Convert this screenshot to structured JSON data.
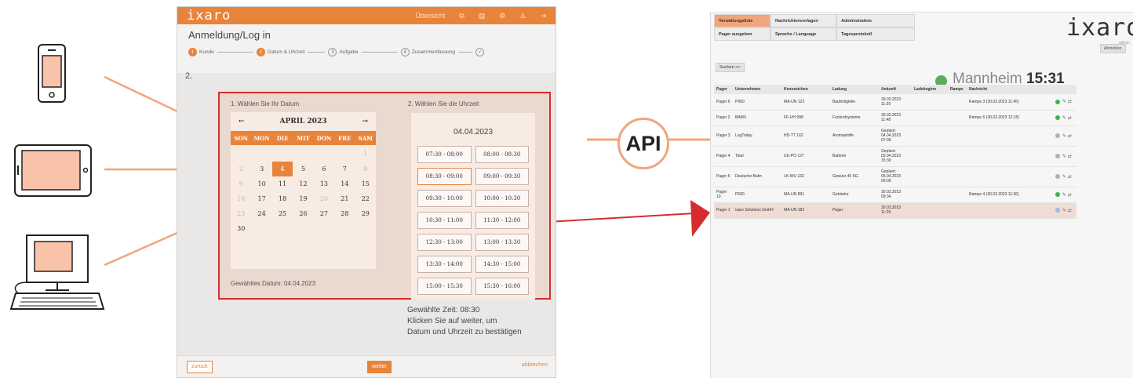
{
  "colors": {
    "brand": "#e8833a",
    "highlight": "#d52d2d",
    "connector": "#f0a57a"
  },
  "devices": [
    {
      "icon": "smartphone-icon"
    },
    {
      "icon": "tablet-icon"
    },
    {
      "icon": "desktop-computer-icon"
    }
  ],
  "api_label": "API",
  "booking_app": {
    "logo": "ixaro",
    "nav": [
      "Übersicht",
      "external-link-icon",
      "calendar-icon",
      "gear-icon",
      "user-icon",
      "logout-icon"
    ],
    "page_title": "Anmeldung/Log in",
    "steps": [
      {
        "num": "1",
        "label": "Kunde"
      },
      {
        "num": "2",
        "label": "Datum & Uhrzeit"
      },
      {
        "num": "3",
        "label": "Aufgabe"
      },
      {
        "num": "4",
        "label": "Zusammenfassung"
      },
      {
        "num": "✓",
        "label": ""
      }
    ],
    "step_number": "2.",
    "date_caption": "1. Wählen Sie Ihr Datum",
    "time_caption": "2. Wählen Sie die Uhrzeit",
    "calendar": {
      "month": "APRIL 2023",
      "prev": "←",
      "next": "→",
      "weekdays": [
        "SON",
        "MON",
        "DIE",
        "MIT",
        "DON",
        "FRE",
        "SAM"
      ],
      "days": [
        {
          "d": "",
          "s": ""
        },
        {
          "d": "",
          "s": ""
        },
        {
          "d": "",
          "s": ""
        },
        {
          "d": "",
          "s": ""
        },
        {
          "d": "",
          "s": ""
        },
        {
          "d": "",
          "s": ""
        },
        {
          "d": "1",
          "s": "muted"
        },
        {
          "d": "2",
          "s": "muted"
        },
        {
          "d": "3",
          "s": ""
        },
        {
          "d": "4",
          "s": "sel"
        },
        {
          "d": "5",
          "s": ""
        },
        {
          "d": "6",
          "s": ""
        },
        {
          "d": "7",
          "s": ""
        },
        {
          "d": "8",
          "s": "muted"
        },
        {
          "d": "9",
          "s": "muted"
        },
        {
          "d": "10",
          "s": ""
        },
        {
          "d": "11",
          "s": ""
        },
        {
          "d": "12",
          "s": ""
        },
        {
          "d": "13",
          "s": ""
        },
        {
          "d": "14",
          "s": ""
        },
        {
          "d": "15",
          "s": ""
        },
        {
          "d": "16",
          "s": "muted"
        },
        {
          "d": "17",
          "s": ""
        },
        {
          "d": "18",
          "s": ""
        },
        {
          "d": "19",
          "s": ""
        },
        {
          "d": "20",
          "s": "muted"
        },
        {
          "d": "21",
          "s": ""
        },
        {
          "d": "22",
          "s": ""
        },
        {
          "d": "23",
          "s": "muted"
        },
        {
          "d": "24",
          "s": ""
        },
        {
          "d": "25",
          "s": ""
        },
        {
          "d": "26",
          "s": ""
        },
        {
          "d": "27",
          "s": ""
        },
        {
          "d": "28",
          "s": ""
        },
        {
          "d": "29",
          "s": ""
        },
        {
          "d": "30",
          "s": ""
        }
      ]
    },
    "chosen_date": "Gewähltes Datum: 04.04.2023",
    "time_date": "04.04.2023",
    "slots": [
      {
        "t": "07:30 - 08:00",
        "s": ""
      },
      {
        "t": "08:00 - 08:30",
        "s": ""
      },
      {
        "t": "08:30 - 09:00",
        "s": "sel"
      },
      {
        "t": "09:00 - 09:30",
        "s": ""
      },
      {
        "t": "09:30 - 10:00",
        "s": ""
      },
      {
        "t": "10:00 - 10:30",
        "s": ""
      },
      {
        "t": "10:30 - 11:00",
        "s": ""
      },
      {
        "t": "11:30 - 12:00",
        "s": ""
      },
      {
        "t": "12:30 - 13:00",
        "s": ""
      },
      {
        "t": "13:00 - 13:30",
        "s": ""
      },
      {
        "t": "13:30 - 14:00",
        "s": ""
      },
      {
        "t": "14:30 - 15:00",
        "s": ""
      },
      {
        "t": "15:00 - 15:30",
        "s": ""
      },
      {
        "t": "15:30 - 16:00",
        "s": ""
      }
    ],
    "chosen_time": [
      "Gewählte Zeit: 08:30",
      "Klicken Sie auf weiter, um",
      "Datum und Uhrzeit zu bestätigen"
    ],
    "back_label": "zurück",
    "next_label": "weiter",
    "abort_label": "abbrechen"
  },
  "dashboard": {
    "tabs": [
      "Verwaltungsliste",
      "Nachrichtenvorlagen",
      "Administration",
      "Pager ausgeben",
      "Sprache / Language",
      "Tagesprotokoll"
    ],
    "logo": "ixaro",
    "admin_label": "admin",
    "logout_label": "Abmelden",
    "search_label": "Suchen >>",
    "city": "Mannheim",
    "time": "15:31",
    "columns": [
      "Pager",
      "Unternehmen",
      "Kennzeichen",
      "Ladung",
      "Ankunft",
      "Ladebeginn",
      "Rampe",
      "Nachricht"
    ],
    "rows": [
      {
        "pager": "Pager 6",
        "company": "P900",
        "plate": "MA-UN 123",
        "cargo": "Baufertigteile",
        "arrival": "30.03.2023 11:29",
        "loading": "",
        "ramp": "",
        "message": "Rampe 3 (30.03.2023 11:45)",
        "status": "#3db34a",
        "hl": ""
      },
      {
        "pager": "Pager 2",
        "company": "BAMX",
        "plate": "FF-UH 998",
        "cargo": "Funkrufsysteme",
        "arrival": "30.03.2023 11:48",
        "loading": "",
        "ramp": "",
        "message": "Rampe 6 (30.03.2023 12:15)",
        "status": "#3db34a",
        "hl": ""
      },
      {
        "pager": "Pager 3",
        "company": "LogToday",
        "plate": "HD-TT 162",
        "cargo": "Aromastoffe",
        "arrival": "Geplant: 04.04.2023 07:09",
        "loading": "",
        "ramp": "",
        "message": "",
        "status": "#b0b0b0",
        "hl": ""
      },
      {
        "pager": "Pager 4",
        "company": "Total",
        "plate": "UU-PO 127",
        "cargo": "Batterie",
        "arrival": "Geplant: 03.04.2023 15:39",
        "loading": "",
        "ramp": "",
        "message": "",
        "status": "#b0b0b0",
        "hl": ""
      },
      {
        "pager": "Pager 5",
        "company": "Deutsche Bahn",
        "plate": "LK-WU 132",
        "cargo": "Gewürz 40 KG",
        "arrival": "Geplant: 05.04.2023 09:09",
        "loading": "",
        "ramp": "",
        "message": "",
        "status": "#b0b0b0",
        "hl": ""
      },
      {
        "pager": "Pager 10",
        "company": "P500",
        "plate": "MA-UN 891",
        "cargo": "Getränke",
        "arrival": "30.03.2023 09:34",
        "loading": "",
        "ramp": "",
        "message": "Rampe 4 (30.03.2023 11:26)",
        "status": "#3db34a",
        "hl": ""
      },
      {
        "pager": "Pager 1",
        "company": "ixaro Solutions GmbH",
        "plate": "MA-UN 182",
        "cargo": "Pager",
        "arrival": "30.03.2023 11:29",
        "loading": "",
        "ramp": "",
        "message": "",
        "status": "#9bbbe0",
        "hl": "hl"
      }
    ]
  }
}
